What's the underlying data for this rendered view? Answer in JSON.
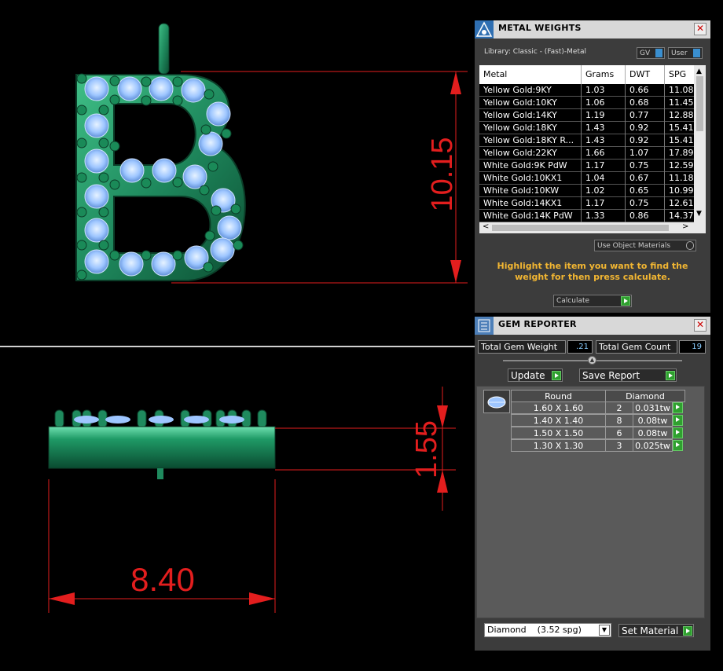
{
  "viewport": {
    "dimensions": {
      "height": "10.15",
      "thickness": "1.55",
      "width": "8.40"
    },
    "letter": "B",
    "dim_color": "#e31e1e",
    "metal_color": "#1f8a5e",
    "gem_color": "#9ec6ff"
  },
  "metal_weights": {
    "title": "METAL WEIGHTS",
    "library_label": "Library: Classic - (Fast)-Metal",
    "gv_label": "GV",
    "user_label": "User",
    "columns": [
      "Metal",
      "Grams",
      "DWT",
      "SPG"
    ],
    "rows": [
      {
        "metal": "Yellow Gold:9KY",
        "grams": "1.03",
        "dwt": "0.66",
        "spg": "11.08"
      },
      {
        "metal": "Yellow Gold:10KY",
        "grams": "1.06",
        "dwt": "0.68",
        "spg": "11.45"
      },
      {
        "metal": "Yellow Gold:14KY",
        "grams": "1.19",
        "dwt": "0.77",
        "spg": "12.88"
      },
      {
        "metal": "Yellow Gold:18KY",
        "grams": "1.43",
        "dwt": "0.92",
        "spg": "15.41"
      },
      {
        "metal": "Yellow Gold:18KY R...",
        "grams": "1.43",
        "dwt": "0.92",
        "spg": "15.41"
      },
      {
        "metal": "Yellow Gold:22KY",
        "grams": "1.66",
        "dwt": "1.07",
        "spg": "17.89"
      },
      {
        "metal": "White Gold:9K PdW",
        "grams": "1.17",
        "dwt": "0.75",
        "spg": "12.59"
      },
      {
        "metal": "White Gold:10KX1",
        "grams": "1.04",
        "dwt": "0.67",
        "spg": "11.18"
      },
      {
        "metal": "White Gold:10KW",
        "grams": "1.02",
        "dwt": "0.65",
        "spg": "10.99"
      },
      {
        "metal": "White Gold:14KX1",
        "grams": "1.17",
        "dwt": "0.75",
        "spg": "12.61"
      },
      {
        "metal": "White Gold:14K PdW",
        "grams": "1.33",
        "dwt": "0.86",
        "spg": "14.37"
      }
    ],
    "use_object_materials": "Use Object Materials",
    "instruction": "Highlight the item you want to find the weight for then press calculate.",
    "calculate_label": "Calculate",
    "accent": "#f2b632"
  },
  "gem_reporter": {
    "title": "GEM REPORTER",
    "total_weight_label": "Total Gem Weight",
    "total_weight_value": ".21",
    "total_count_label": "Total Gem Count",
    "total_count_value": "19",
    "update_label": "Update",
    "save_report_label": "Save Report",
    "shape_header": "Round",
    "material_header": "Diamond",
    "rows": [
      {
        "size": "1.60 X 1.60",
        "count": "2",
        "weight": "0.031tw"
      },
      {
        "size": "1.40 X 1.40",
        "count": "8",
        "weight": "0.08tw"
      },
      {
        "size": "1.50 X 1.50",
        "count": "6",
        "weight": "0.08tw"
      },
      {
        "size": "1.30 X 1.30",
        "count": "3",
        "weight": "0.025tw"
      }
    ],
    "material_select": "Diamond    (3.52 spg)",
    "set_material_label": "Set Material"
  }
}
